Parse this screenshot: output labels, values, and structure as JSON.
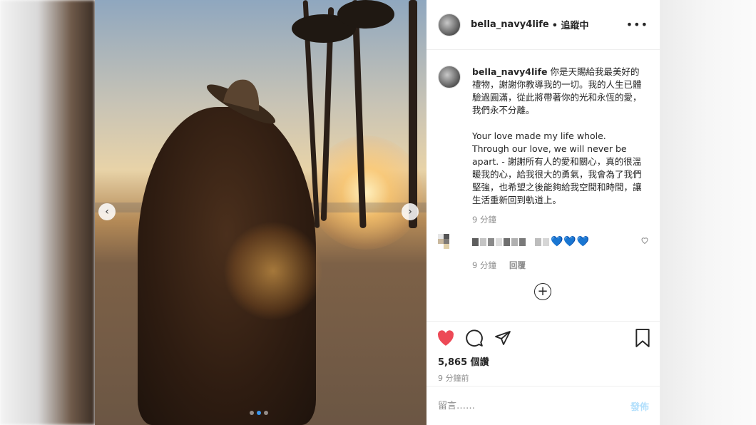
{
  "post": {
    "username": "bella_navy4life",
    "follow_label": "• 追蹤中",
    "more_label": "•••",
    "caption_user": "bella_navy4life",
    "caption_text": " 你是天賜給我最美好的禮物，謝謝你教導我的一切。我的人生已體驗過圓滿，從此將帶著你的光和永恆的愛，我們永不分離。\n\nYour love made my life whole. Through our love, we will never be apart. - 謝謝所有人的愛和關心，真的很溫暖我的心，給我很大的勇氣，我會為了我們堅強，也希望之後能夠給我空間和時間，讓生活重新回到軌道上。",
    "caption_time": "9 分鐘",
    "comment_hearts": "💙💙💙",
    "comment_time": "9 分鐘",
    "reply_label": "回覆",
    "load_more_label": "+",
    "likes": "5,865 個讚",
    "posted_ago": "9 分鐘前",
    "comment_placeholder": "留言……",
    "post_button_label": "發佈",
    "prev_label": "‹",
    "next_label": "›"
  },
  "icons": {
    "like": "heart-icon",
    "comment": "comment-icon",
    "share": "share-icon",
    "save": "bookmark-icon",
    "more": "more-icon",
    "comment_like": "small-heart-icon",
    "load_more": "plus-circle-icon"
  },
  "colors": {
    "like_red": "#ed4956",
    "text": "#262626",
    "muted": "#8e8e8e",
    "post_button": "#b2dffc",
    "carousel_active_dot": "#3897f0"
  },
  "carousel": {
    "count": 3,
    "active_index": 1
  }
}
